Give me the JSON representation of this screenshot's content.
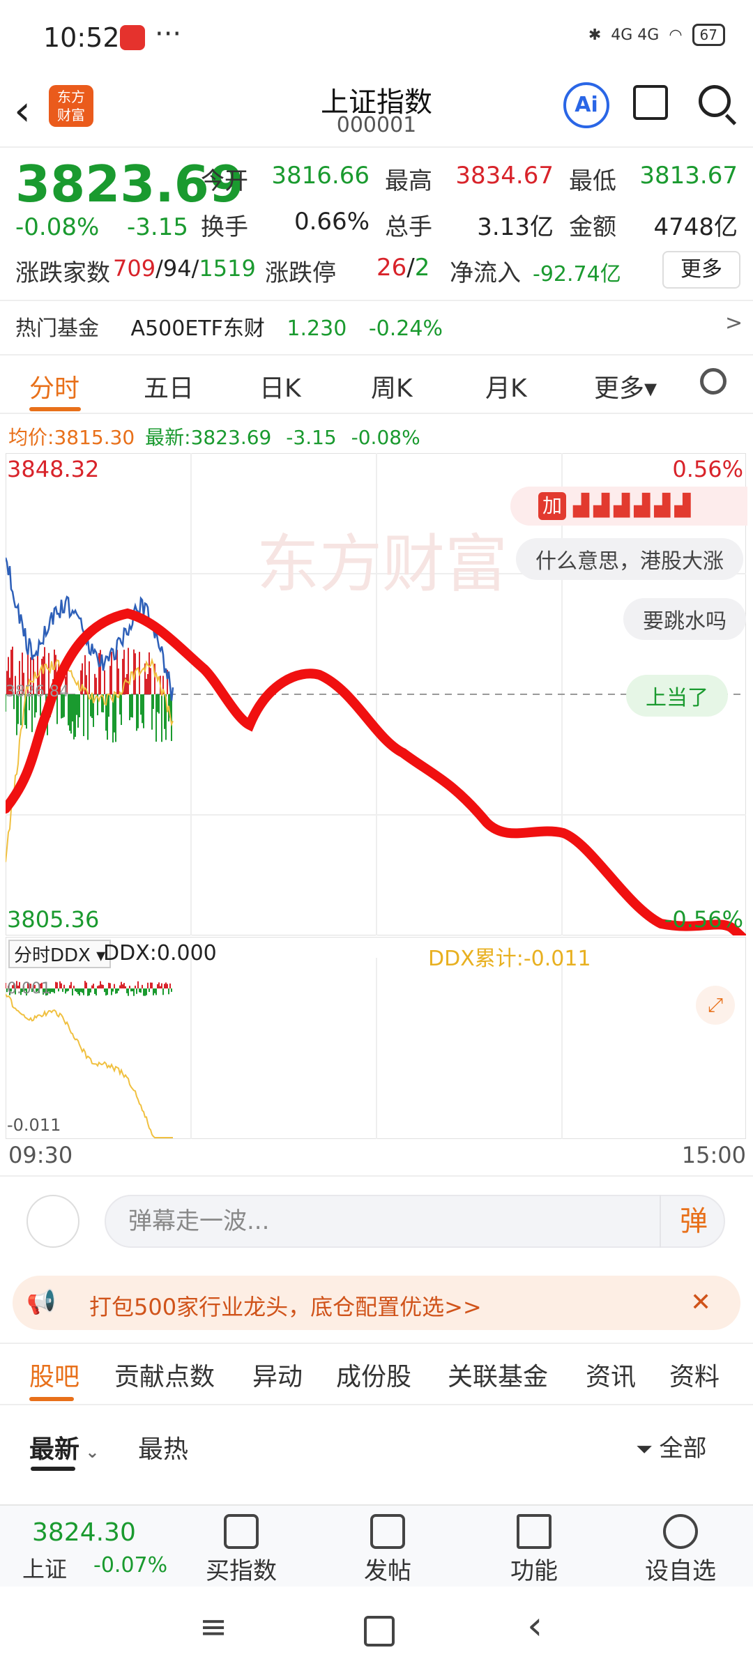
{
  "status": {
    "time": "10:52",
    "dots": "···",
    "signal": "4G 4G",
    "battery": "67"
  },
  "header": {
    "title": "上证指数",
    "code": "000001",
    "logo": "东方\n财富",
    "ai": "Ai"
  },
  "quote": {
    "price": "3823.69",
    "chg_pct": "-0.08%",
    "chg": "-3.15",
    "open_label": "今开",
    "open": "3816.66",
    "high_label": "最高",
    "high": "3834.67",
    "low_label": "最低",
    "low": "3813.67",
    "turnover_label": "换手",
    "turnover": "0.66%",
    "volume_label": "总手",
    "volume": "3.13亿",
    "amount_label": "金额",
    "amount": "4748亿",
    "updown_label": "涨跌家数",
    "up": "709",
    "flat": "94",
    "down": "1519",
    "limit_label": "涨跌停",
    "limit_up": "26",
    "limit_down": "2",
    "inflow_label": "净流入",
    "inflow": "-92.74亿",
    "more_button": "更多"
  },
  "hot_fund": {
    "label": "热门基金",
    "name": "A500ETF东财",
    "price": "1.230",
    "chg": "-0.24%",
    "arrow": ">"
  },
  "chart_tabs": [
    {
      "label": "分时",
      "active": true
    },
    {
      "label": "五日"
    },
    {
      "label": "日K"
    },
    {
      "label": "周K"
    },
    {
      "label": "月K"
    },
    {
      "label": "更多▾"
    }
  ],
  "avg_line": {
    "avg_label": "均价:",
    "avg": "3815.30",
    "last_label": "最新:",
    "last": "3823.69",
    "chg": "-3.15",
    "chg_pct": "-0.08%"
  },
  "chart": {
    "y_max": "3848.32",
    "y_min": "3805.36",
    "pct_max": "0.56%",
    "pct_min": "-0.56%",
    "prev_close_label": "3826.84",
    "watermark": "东方财富",
    "danmu_tag": "加",
    "bubbles": [
      "什么意思，港股大涨",
      "要跳水吗",
      "上当了"
    ]
  },
  "ddx": {
    "selector": "分时DDX ▾",
    "ddx_value": "DDX:0.000",
    "ddx_total": "DDX累计:-0.011",
    "top": "0.001",
    "bottom": "-0.011"
  },
  "time_axis": {
    "start": "09:30",
    "end": "15:00"
  },
  "danmu": {
    "placeholder": "弹幕走一波...",
    "button": "弹"
  },
  "promo": {
    "text": "打包500家行业龙头，底仓配置优选>>",
    "close": "✕"
  },
  "bottom_tabs": [
    "股吧",
    "贡献点数",
    "异动",
    "成份股",
    "关联基金",
    "资讯",
    "资料"
  ],
  "sort": {
    "latest": "最新",
    "hot": "最热",
    "filter": "全部"
  },
  "bottom_bar": {
    "price": "3824.30",
    "name": "上证",
    "chg": "-0.07%",
    "items": [
      "买指数",
      "发帖",
      "功能",
      "设自选"
    ]
  }
}
